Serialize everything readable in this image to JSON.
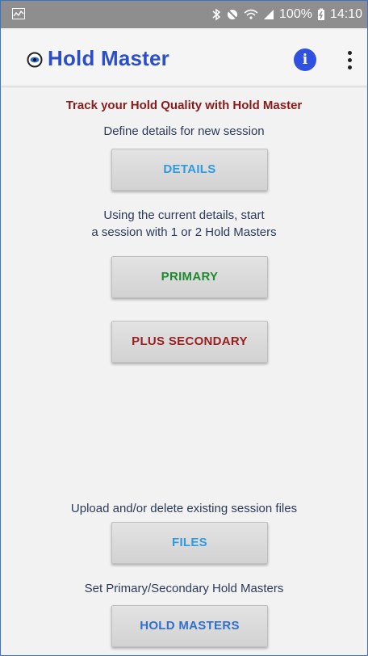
{
  "statusbar": {
    "battery": "100%",
    "time": "14:10"
  },
  "appbar": {
    "title": "Hold Master",
    "info_label": "i"
  },
  "main": {
    "tagline": "Track your Hold Quality with Hold Master",
    "details_prompt": "Define details for new session",
    "details_button": "DETAILS",
    "session_prompt_line1": "Using the current details, start",
    "session_prompt_line2": "a session with 1 or 2 Hold Masters",
    "primary_button": "PRIMARY",
    "plus_secondary_button": "PLUS SECONDARY",
    "files_prompt": "Upload and/or delete existing session files",
    "files_button": "FILES",
    "hold_masters_prompt": "Set Primary/Secondary Hold Masters",
    "hold_masters_button": "HOLD MASTERS"
  },
  "colors": {
    "title": "#2b4fc9",
    "tagline": "#8b1a1a",
    "details_button_text": "#2f9ae0",
    "primary_button_text": "#1e8a2e",
    "plus_secondary_button_text": "#9a1f1f",
    "files_button_text": "#2f9ae0",
    "hold_masters_button_text": "#2f6fd0"
  }
}
